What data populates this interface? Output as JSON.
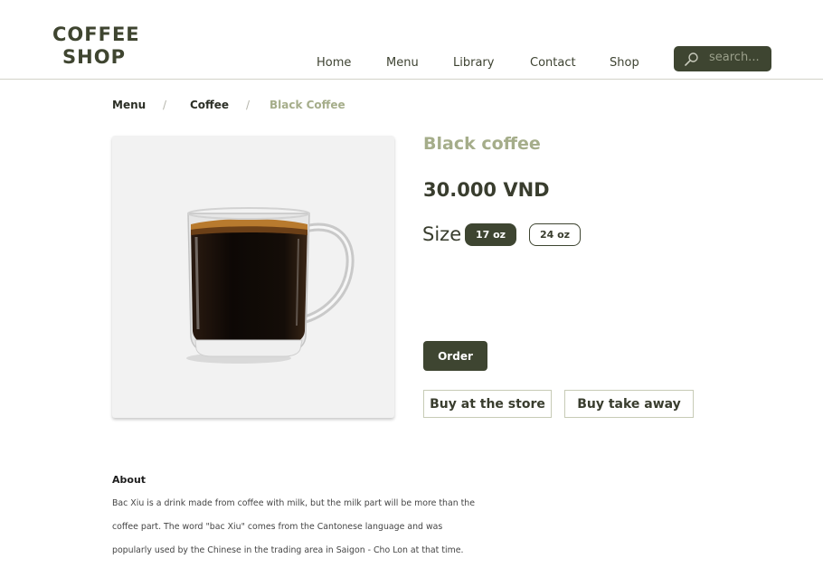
{
  "header": {
    "logo_line1": "COFFEE",
    "logo_line2": "SHOP",
    "nav": [
      "Home",
      "Menu",
      "Library",
      "Contact",
      "Shop"
    ],
    "search": {
      "placeholder": "search..."
    }
  },
  "breadcrumb": {
    "items": [
      "Menu",
      "Coffee",
      "Black Coffee"
    ],
    "separator": "/"
  },
  "product": {
    "title": "Black coffee",
    "price": "30.000 VND",
    "size_label": "Size",
    "sizes": [
      "17 oz",
      "24 oz"
    ],
    "selected_size": "17 oz",
    "order_label": "Order",
    "buy_store_label": "Buy at the store",
    "buy_takeaway_label": "Buy take away",
    "image": "coffee-mug-image"
  },
  "about": {
    "heading": "About",
    "lines": [
      "Bac Xiu is a drink made from coffee with milk, but the milk part will be more than the",
      "coffee part. The word \"bac Xiu\" comes from the Cantonese language and was",
      "popularly used by the Chinese in the trading area in Saigon - Cho Lon at that time."
    ]
  },
  "colors": {
    "brand_dark": "#3e4531",
    "accent_olive": "#a5ad8a",
    "text_dark": "#393d2e",
    "image_bg": "#f2f2f2"
  }
}
